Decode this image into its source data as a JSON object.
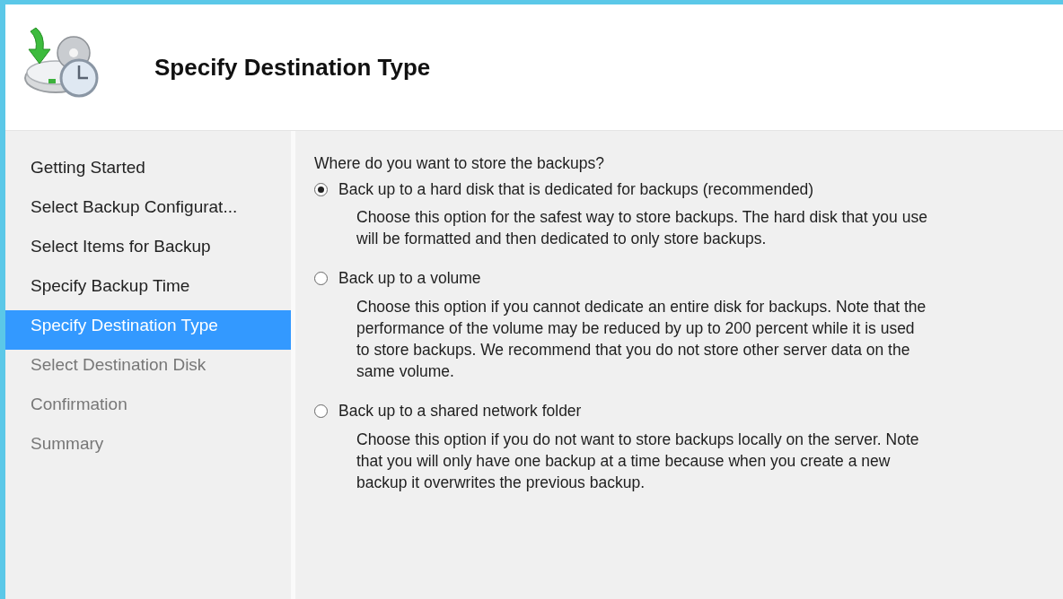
{
  "header": {
    "title": "Specify Destination Type"
  },
  "steps": [
    {
      "label": "Getting Started",
      "selected": false,
      "disabled": false
    },
    {
      "label": "Select Backup Configurat...",
      "selected": false,
      "disabled": false
    },
    {
      "label": "Select Items for Backup",
      "selected": false,
      "disabled": false
    },
    {
      "label": "Specify Backup Time",
      "selected": false,
      "disabled": false
    },
    {
      "label": "Specify Destination Type",
      "selected": true,
      "disabled": false
    },
    {
      "label": "Select Destination Disk",
      "selected": false,
      "disabled": true
    },
    {
      "label": "Confirmation",
      "selected": false,
      "disabled": true
    },
    {
      "label": "Summary",
      "selected": false,
      "disabled": true
    }
  ],
  "question": "Where do you want to store the backups?",
  "options": [
    {
      "label": "Back up to a hard disk that is dedicated for backups (recommended)",
      "selected": true,
      "description": [
        "Choose this option for the safest way to store backups. The hard disk that you use",
        "will be formatted and then dedicated to only store backups."
      ]
    },
    {
      "label": "Back up to a volume",
      "selected": false,
      "description": [
        "Choose this option if you cannot dedicate an entire disk for backups. Note that the",
        "performance of the volume may be reduced by up to 200 percent while it is used",
        "to store backups. We recommend that you do not store other server data on the",
        "same volume."
      ]
    },
    {
      "label": "Back up to a shared network folder",
      "selected": false,
      "description": [
        "Choose this option if you do not want to store backups locally on the server. Note",
        "that you will only have one backup at a time because when you create a new",
        "backup it overwrites the previous backup."
      ]
    }
  ]
}
